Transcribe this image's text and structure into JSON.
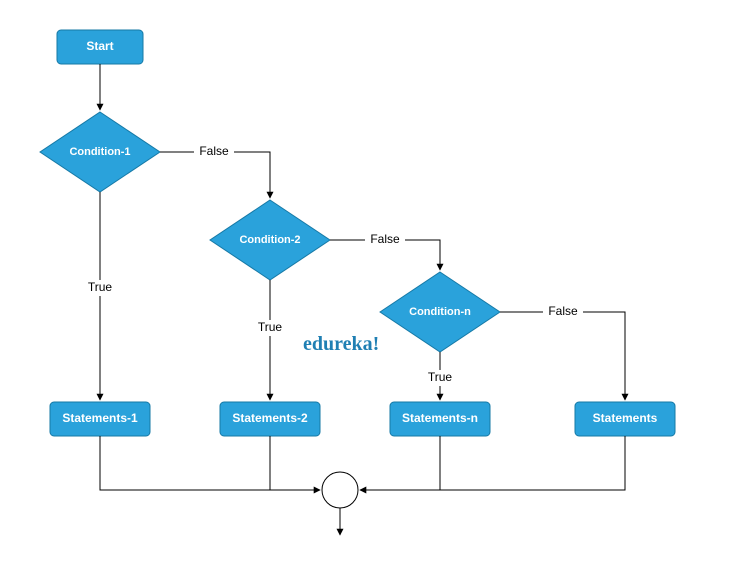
{
  "nodes": {
    "start": "Start",
    "cond1": "Condition-1",
    "cond2": "Condition-2",
    "condn": "Condition-n",
    "stmt1": "Statements-1",
    "stmt2": "Statements-2",
    "stmtn": "Statements-n",
    "stmt": "Statements"
  },
  "labels": {
    "true": "True",
    "false": "False"
  },
  "brand": "edureka!",
  "colors": {
    "node_fill": "#2aa2db",
    "node_stroke": "#1679a6",
    "brand": "#1f7fb3"
  }
}
